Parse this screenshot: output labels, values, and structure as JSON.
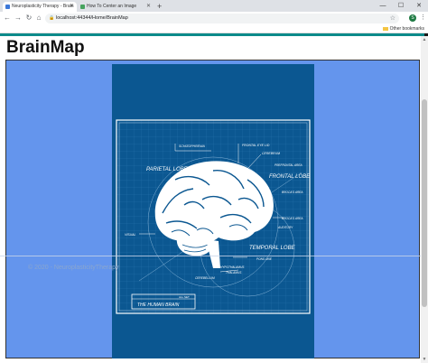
{
  "browser": {
    "tabs": [
      {
        "label": "Neuroplasticity Therapy - Brain",
        "active": true,
        "icon_color": "#3c78d8"
      },
      {
        "label": "How To Center an Image",
        "active": false,
        "icon_color": "#46a35e"
      }
    ],
    "new_tab_glyph": "+",
    "window_controls": {
      "minimize": "—",
      "maximize": "☐",
      "close": "✕"
    },
    "nav": {
      "back": "←",
      "forward": "→",
      "reload": "↻",
      "home": "⌂"
    },
    "url": "localhost:44344/Home/BrainMap",
    "avatar_letter": "S",
    "bookmarks": {
      "other": "Other bookmarks"
    }
  },
  "page": {
    "title": "BrainMap",
    "footer": "© 2020 - NeuroplasticityTherapy"
  },
  "brain_image": {
    "plate_title": "THE HUMAN BRAIN",
    "plate_sub": "ALL SET",
    "labels": {
      "schizophrenia": "SCHIZOPHRENIA",
      "frontal_eye": "FRONTAL EYE LID",
      "cerebrum": "CEREBRUM",
      "prefrontal": "PREFRONTAL AREA",
      "parietal": "PARIETAL LOBE",
      "frontal": "FRONTAL LOBE",
      "brocas": "BROCA'S AREA",
      "brocas2": "BROCA'S AREA",
      "auditory": "AUDITORY",
      "visual": "VISUAL",
      "temporal": "TEMPORAL LOBE",
      "pons": "PONS ONE",
      "hypothalamus": "HYPOTHALAMUS",
      "thalamus": "THALAMUS",
      "cerebellum": "CEREBELLUM"
    }
  },
  "colors": {
    "map_bg": "#6495ed",
    "blueprint": "#0b5791",
    "accent": "#0d8a8a"
  }
}
